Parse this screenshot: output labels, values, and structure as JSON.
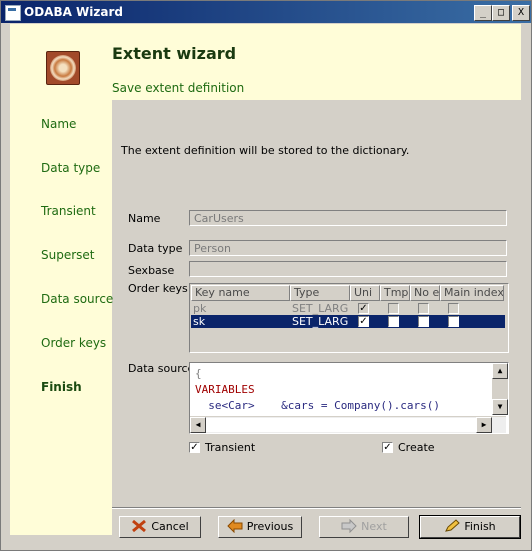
{
  "window": {
    "title": "ODABA Wizard",
    "controls": [
      "_",
      "□",
      "X"
    ]
  },
  "steps": [
    {
      "label": "Name",
      "active": false
    },
    {
      "label": "Data type",
      "active": false
    },
    {
      "label": "Transient",
      "active": false
    },
    {
      "label": "Superset",
      "active": false
    },
    {
      "label": "Data source",
      "active": false
    },
    {
      "label": "Order keys",
      "active": false
    },
    {
      "label": "Finish",
      "active": true
    }
  ],
  "header": {
    "title": "Extent wizard",
    "subtitle": "Save extent definition"
  },
  "description": "The extent definition will be stored to the dictionary.",
  "form": {
    "name_label": "Name",
    "name_value": "CarUsers",
    "datatype_label": "Data type",
    "datatype_value": "Person",
    "sexbase_label": "Sexbase",
    "sexbase_value": "",
    "orderkeys_label": "Order keys",
    "datasource_label": "Data source"
  },
  "orderkeys": {
    "columns": [
      "Key name",
      "Type",
      "Uni",
      "Tmp",
      "No e",
      "Main index"
    ],
    "rows": [
      {
        "key": "pk",
        "type": "SET_LARG",
        "uni": true,
        "tmp": false,
        "noe": false,
        "main": false,
        "selected": false
      },
      {
        "key": "sk",
        "type": "SET_LARG",
        "uni": true,
        "tmp": false,
        "noe": false,
        "main": false,
        "selected": true
      }
    ]
  },
  "code": {
    "line1": "{",
    "line2": "VARIABLES",
    "line3": "  se<Car>    &cars = Company().cars()"
  },
  "options": {
    "transient_label": "Transient",
    "transient_checked": true,
    "create_label": "Create",
    "create_checked": true
  },
  "buttons": {
    "cancel": "Cancel",
    "previous": "Previous",
    "next": "Next",
    "finish": "Finish"
  },
  "colors": {
    "accent_green": "#1f6b12",
    "panel_yellow": "#fffdd8",
    "selection": "#0a246a",
    "keyword_red": "#a00000"
  }
}
